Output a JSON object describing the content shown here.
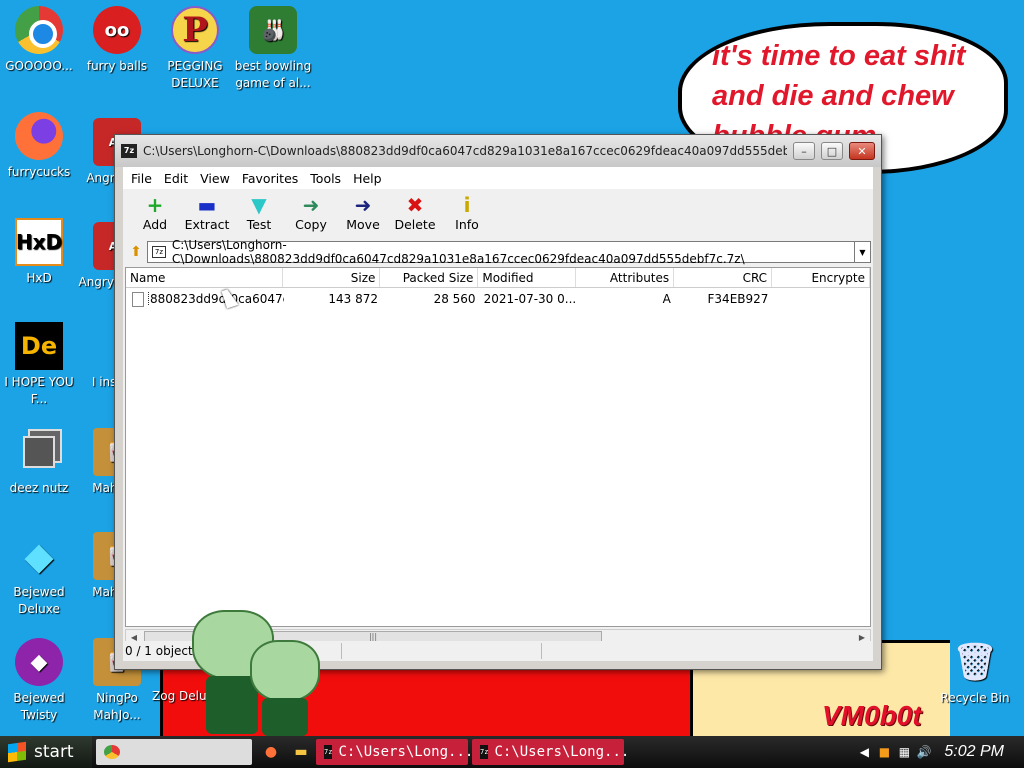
{
  "desktop": {
    "icons_left": [
      {
        "label": "GOOOOO...",
        "glyph": ""
      },
      {
        "label": "furrycucks",
        "glyph": ""
      },
      {
        "label": "HxD",
        "glyph": "HxD"
      },
      {
        "label": "I HOPE YOU F...",
        "glyph": "De"
      },
      {
        "label": "deez nutz",
        "glyph": ""
      },
      {
        "label": "Bejewed Deluxe",
        "glyph": "◆"
      },
      {
        "label": "Bejewed Twisty",
        "glyph": "◆"
      }
    ],
    "icons_second": [
      {
        "label": "furry balls",
        "glyph": "oo"
      },
      {
        "label": "Angry Soy",
        "glyph": "AS"
      },
      {
        "label": "Angry Soy W",
        "glyph": "AS"
      },
      {
        "label": "I ins this",
        "glyph": ""
      },
      {
        "label": "Mah Esc",
        "glyph": "🀄"
      },
      {
        "label": "Mah Esc",
        "glyph": "🀄"
      },
      {
        "label": "NingPo MahJo...",
        "glyph": "🀄"
      }
    ],
    "icons_top": [
      {
        "label": "PEGGING DELUXE",
        "glyph": "P"
      },
      {
        "label": "best bowling game of al...",
        "glyph": "🎳"
      }
    ],
    "partial_label": "Zog Delu",
    "recycle_bin": {
      "label": "Recycle Bin",
      "glyph": "🗑"
    },
    "bubble_text": "it's time to eat shit and die and chew bubble gum",
    "watermark": "VM0b0t"
  },
  "window": {
    "app_icon": "7z",
    "title": "C:\\Users\\Longhorn-C\\Downloads\\880823dd9df0ca6047cd829a1031e8a167ccec0629fdeac40a097dd555deb...",
    "controls": {
      "minimize": "–",
      "maximize": "□",
      "close": "✕"
    },
    "menu": [
      "File",
      "Edit",
      "View",
      "Favorites",
      "Tools",
      "Help"
    ],
    "toolbar": [
      {
        "label": "Add",
        "icon": "+",
        "color": "#1fa82a"
      },
      {
        "label": "Extract",
        "icon": "▬",
        "color": "#1930c8"
      },
      {
        "label": "Test",
        "icon": "▼",
        "color": "#2cc7c7"
      },
      {
        "label": "Copy",
        "icon": "➜",
        "color": "#2e8a5a"
      },
      {
        "label": "Move",
        "icon": "➜",
        "color": "#1a237e"
      },
      {
        "label": "Delete",
        "icon": "✖",
        "color": "#d91313"
      },
      {
        "label": "Info",
        "icon": "i",
        "color": "#c9a800"
      }
    ],
    "address": "C:\\Users\\Longhorn-C\\Downloads\\880823dd9df0ca6047cd829a1031e8a167ccec0629fdeac40a097dd555debf7c.7z\\",
    "columns": [
      "Name",
      "Size",
      "Packed Size",
      "Modified",
      "Attributes",
      "CRC",
      "Encrypte"
    ],
    "rows": [
      {
        "name": "880823dd9df0ca6047c...",
        "size": "143 872",
        "packed": "28 560",
        "modified": "2021-07-30 0...",
        "attributes": "A",
        "crc": "F34EB927",
        "encrypted": ""
      }
    ],
    "status": "0 / 1 object(s) selected"
  },
  "taskbar": {
    "start": "start",
    "tasks": [
      {
        "label": "",
        "type": "chrome"
      },
      {
        "label": "C:\\Users\\Long...",
        "type": "zip"
      },
      {
        "label": "C:\\Users\\Long...",
        "type": "zip"
      }
    ],
    "clock": "5:02 PM"
  }
}
